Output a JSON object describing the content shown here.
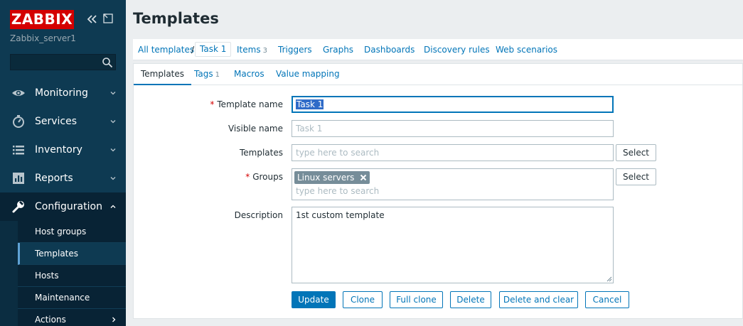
{
  "sidebar": {
    "logo": "ZABBIX",
    "server_name": "Zabbix_server1",
    "search_placeholder": "",
    "menu": [
      {
        "label": "Monitoring",
        "icon": "eye-icon"
      },
      {
        "label": "Services",
        "icon": "stopwatch-icon"
      },
      {
        "label": "Inventory",
        "icon": "list-icon"
      },
      {
        "label": "Reports",
        "icon": "bar-chart-icon"
      },
      {
        "label": "Configuration",
        "icon": "wrench-icon"
      }
    ],
    "submenu": [
      {
        "label": "Host groups"
      },
      {
        "label": "Templates"
      },
      {
        "label": "Hosts"
      },
      {
        "label": "Maintenance"
      },
      {
        "label": "Actions"
      }
    ]
  },
  "page": {
    "title": "Templates"
  },
  "nav_tabs": {
    "all_templates": "All templates",
    "separator": "/",
    "current": "Task 1",
    "items": "Items",
    "items_count": "3",
    "triggers": "Triggers",
    "graphs": "Graphs",
    "dashboards": "Dashboards",
    "discovery_rules": "Discovery rules",
    "web_scenarios": "Web scenarios"
  },
  "form_tabs": {
    "templates": "Templates",
    "tags": "Tags",
    "tags_count": "1",
    "macros": "Macros",
    "value_mapping": "Value mapping"
  },
  "form": {
    "template_name_label": "Template name",
    "template_name_value": "Task 1",
    "visible_name_label": "Visible name",
    "visible_name_placeholder": "Task 1",
    "templates_label": "Templates",
    "templates_placeholder": "type here to search",
    "groups_label": "Groups",
    "groups_chip": "Linux servers",
    "groups_placeholder": "type here to search",
    "description_label": "Description",
    "description_value": "1st custom template",
    "select_label": "Select",
    "required_mark": "*"
  },
  "actions": {
    "update": "Update",
    "clone": "Clone",
    "full_clone": "Full clone",
    "delete": "Delete",
    "delete_and_clear": "Delete and clear",
    "cancel": "Cancel"
  },
  "colors": {
    "sidebar_bg": "#0e3a52",
    "logo_red": "#d40000",
    "link_blue": "#0275b8",
    "chip_gray": "#768d99"
  }
}
